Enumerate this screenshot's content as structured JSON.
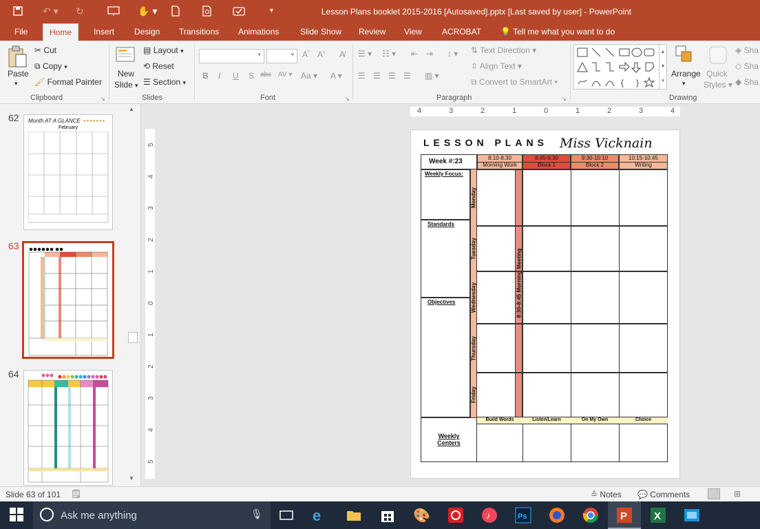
{
  "window": {
    "title": "Lesson Plans booklet 2015-2016 [Autosaved].pptx [Last saved by user] - PowerPoint"
  },
  "tabs": [
    "File",
    "Home",
    "Insert",
    "Design",
    "Transitions",
    "Animations",
    "Slide Show",
    "Review",
    "View",
    "ACROBAT"
  ],
  "tell_me": "Tell me what you want to do",
  "ribbon": {
    "clipboard": {
      "paste": "Paste",
      "cut": "Cut",
      "copy": "Copy",
      "format_painter": "Format Painter",
      "label": "Clipboard"
    },
    "slides": {
      "new_slide_1": "New",
      "new_slide_2": "Slide",
      "layout": "Layout",
      "reset": "Reset",
      "section": "Section",
      "label": "Slides"
    },
    "font": {
      "bold": "B",
      "italic": "I",
      "underline": "U",
      "shadow": "S",
      "strike": "abc",
      "aa": "AV",
      "case": "Aa",
      "label": "Font"
    },
    "paragraph": {
      "text_direction": "Text Direction",
      "align_text": "Align Text",
      "convert_smartart": "Convert to SmartArt",
      "label": "Paragraph"
    },
    "drawing": {
      "arrange": "Arrange",
      "quick_styles_1": "Quick",
      "quick_styles_2": "Styles",
      "shape1": "Sha",
      "shape2": "Sha",
      "shape3": "Sha",
      "label": "Drawing"
    }
  },
  "thumbnails": [
    {
      "num": "62",
      "title": "February",
      "heading": "Month AT A GLANCE"
    },
    {
      "num": "63",
      "selected": true
    },
    {
      "num": "64"
    }
  ],
  "ruler": {
    "h": [
      "4",
      "3",
      "2",
      "1",
      "0",
      "1",
      "2",
      "3",
      "4"
    ],
    "v": [
      "5",
      "4",
      "3",
      "2",
      "1",
      "0",
      "1",
      "2",
      "3",
      "4",
      "5"
    ]
  },
  "slide": {
    "header_left": "LESSON PLANS",
    "header_right": "Miss Vicknain",
    "week": "Week #:23",
    "cols": [
      {
        "time": "8:10-8:30",
        "name": "Morning Work"
      },
      {
        "time": "8:45-9:30",
        "name": "Block 1"
      },
      {
        "time": "9:30-10:10",
        "name": "Block 2"
      },
      {
        "time": "10:15-10:45",
        "name": "Writing"
      }
    ],
    "left_labels": [
      "Weekly Focus:",
      "Standards",
      "Objectives"
    ],
    "days": [
      "Monday",
      "Tuesday",
      "Wednesday",
      "Thursday",
      "Friday"
    ],
    "meeting": "8:30-8:45 Morning Meeting",
    "centers_label_1": "Weekly",
    "centers_label_2": "Centers",
    "centers": [
      "Build Words",
      "Listen/Learn",
      "On My Own",
      "Choice"
    ]
  },
  "status": {
    "slide_of": "Slide 63 of 101",
    "notes": "Notes",
    "comments": "Comments"
  },
  "taskbar": {
    "search": "Ask me anything"
  }
}
